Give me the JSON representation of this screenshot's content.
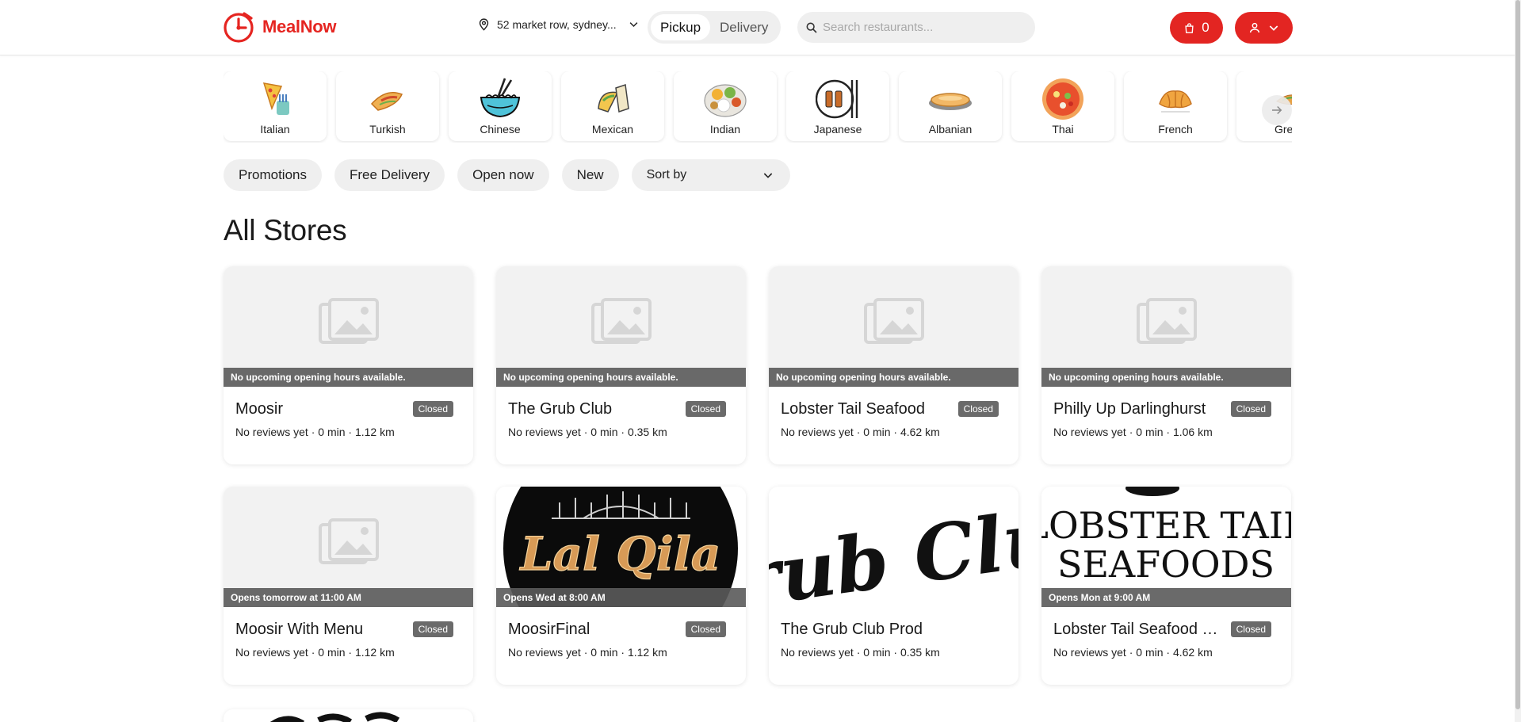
{
  "header": {
    "brand": "MealNow",
    "address": "52 market row, sydney...",
    "modes": [
      {
        "label": "Pickup",
        "active": true
      },
      {
        "label": "Delivery",
        "active": false
      }
    ],
    "search_placeholder": "Search restaurants...",
    "cart_count": "0",
    "brand_color": "#e52521"
  },
  "cuisines": [
    {
      "label": "Italian",
      "icon": "pizza-icon"
    },
    {
      "label": "Turkish",
      "icon": "wrap-icon"
    },
    {
      "label": "Chinese",
      "icon": "noodle-bowl-icon"
    },
    {
      "label": "Mexican",
      "icon": "taco-icon"
    },
    {
      "label": "Indian",
      "icon": "thali-icon"
    },
    {
      "label": "Japanese",
      "icon": "tea-cup-icon"
    },
    {
      "label": "Albanian",
      "icon": "bread-icon"
    },
    {
      "label": "Thai",
      "icon": "curry-bowl-icon"
    },
    {
      "label": "French",
      "icon": "croissant-icon"
    },
    {
      "label": "Gre",
      "icon": "gyro-icon"
    }
  ],
  "filters": {
    "chips": [
      "Promotions",
      "Free Delivery",
      "Open now",
      "New"
    ],
    "sort_label": "Sort by"
  },
  "section_title": "All Stores",
  "stores": [
    {
      "name": "Moosir",
      "hours": "No upcoming opening hours available.",
      "status": "Closed",
      "reviews": "No reviews yet",
      "time": "0 min",
      "distance": "1.12 km",
      "media": "placeholder"
    },
    {
      "name": "The Grub Club",
      "hours": "No upcoming opening hours available.",
      "status": "Closed",
      "reviews": "No reviews yet",
      "time": "0 min",
      "distance": "0.35 km",
      "media": "placeholder"
    },
    {
      "name": "Lobster Tail Seafood",
      "hours": "No upcoming opening hours available.",
      "status": "Closed",
      "reviews": "No reviews yet",
      "time": "0 min",
      "distance": "4.62 km",
      "media": "placeholder"
    },
    {
      "name": "Philly Up Darlinghurst",
      "hours": "No upcoming opening hours available.",
      "status": "Closed",
      "reviews": "No reviews yet",
      "time": "0 min",
      "distance": "1.06 km",
      "media": "placeholder"
    },
    {
      "name": "Moosir With Menu",
      "hours": "Opens tomorrow at 11:00 AM",
      "status": "Closed",
      "reviews": "No reviews yet",
      "time": "0 min",
      "distance": "1.12 km",
      "media": "placeholder"
    },
    {
      "name": "MoosirFinal",
      "hours": "Opens Wed at 8:00 AM",
      "status": "Closed",
      "reviews": "No reviews yet",
      "time": "0 min",
      "distance": "1.12 km",
      "media": "lal-qila-logo",
      "logo_text": "Lal Qila"
    },
    {
      "name": "The Grub Club Prod",
      "hours": "",
      "status": "",
      "reviews": "No reviews yet",
      "time": "0 min",
      "distance": "0.35 km",
      "media": "grub-club-logo",
      "logo_text": "Grub Club"
    },
    {
      "name": "Lobster Tail Seafood Pr...",
      "hours": "Opens Mon at 9:00 AM",
      "status": "Closed",
      "reviews": "No reviews yet",
      "time": "0 min",
      "distance": "4.62 km",
      "media": "lobster-tail-logo",
      "logo_lines": [
        "LOBSTER TAIL",
        "SEAFOODS"
      ]
    }
  ],
  "separator": "·"
}
